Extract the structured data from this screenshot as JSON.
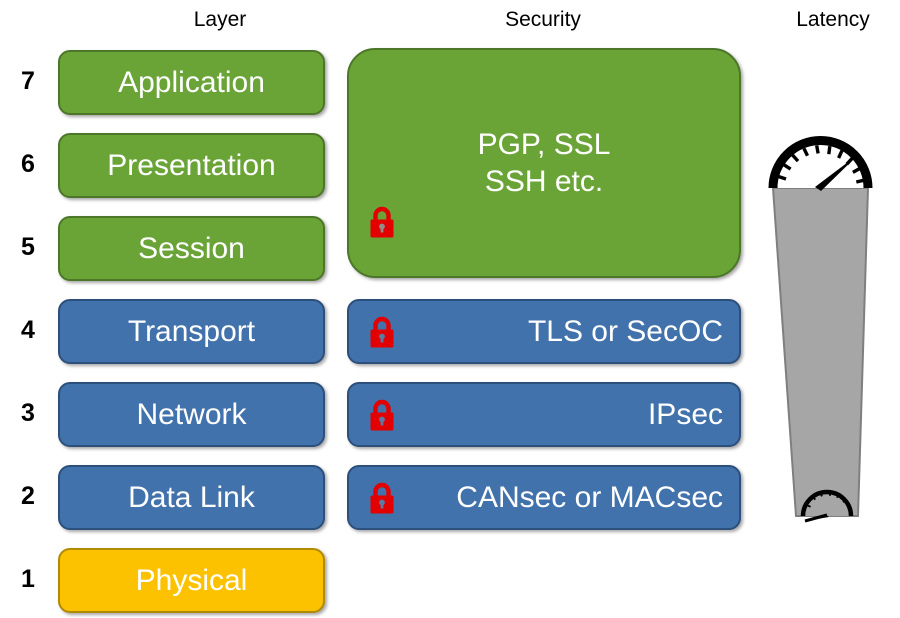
{
  "headers": {
    "layer": "Layer",
    "security": "Security",
    "latency": "Latency"
  },
  "colors": {
    "green_fill": "#6aa437",
    "green_border": "#4c7728",
    "blue_fill": "#4272ab",
    "blue_border": "#2c4f7c",
    "yellow_fill": "#fcc200",
    "yellow_border": "#b08b00",
    "lock_red": "#e20000",
    "funnel_grey": "#a6a6a6",
    "funnel_border": "#7f7f7f",
    "text_white": "#ffffff",
    "text_black": "#000000"
  },
  "layers": [
    {
      "number": "7",
      "name": "Application",
      "color": "green"
    },
    {
      "number": "6",
      "name": "Presentation",
      "color": "green"
    },
    {
      "number": "5",
      "name": "Session",
      "color": "green"
    },
    {
      "number": "4",
      "name": "Transport",
      "color": "blue"
    },
    {
      "number": "3",
      "name": "Network",
      "color": "blue"
    },
    {
      "number": "2",
      "name": "Data Link",
      "color": "blue"
    },
    {
      "number": "1",
      "name": "Physical",
      "color": "yellow"
    }
  ],
  "security_blocks": [
    {
      "id": "upper",
      "spans_layers": "7-5",
      "text_line_1": "PGP, SSL",
      "text_line_2": "SSH etc.",
      "color": "green",
      "lock": "lock-icon"
    },
    {
      "id": "transport",
      "spans_layers": "4",
      "text": "TLS or SecOC",
      "color": "blue",
      "lock": "lock-icon"
    },
    {
      "id": "network",
      "spans_layers": "3",
      "text": "IPsec",
      "color": "blue",
      "lock": "lock-icon"
    },
    {
      "id": "datalink",
      "spans_layers": "2",
      "text": "CANsec or MACsec",
      "color": "blue",
      "lock": "lock-icon"
    }
  ],
  "latency": {
    "shape": "tapered-funnel",
    "top_gauge": "speedometer-high-icon",
    "bottom_gauge": "speedometer-low-icon",
    "meaning_top": "high latency at upper layers",
    "meaning_bottom": "low latency at lower layers"
  }
}
